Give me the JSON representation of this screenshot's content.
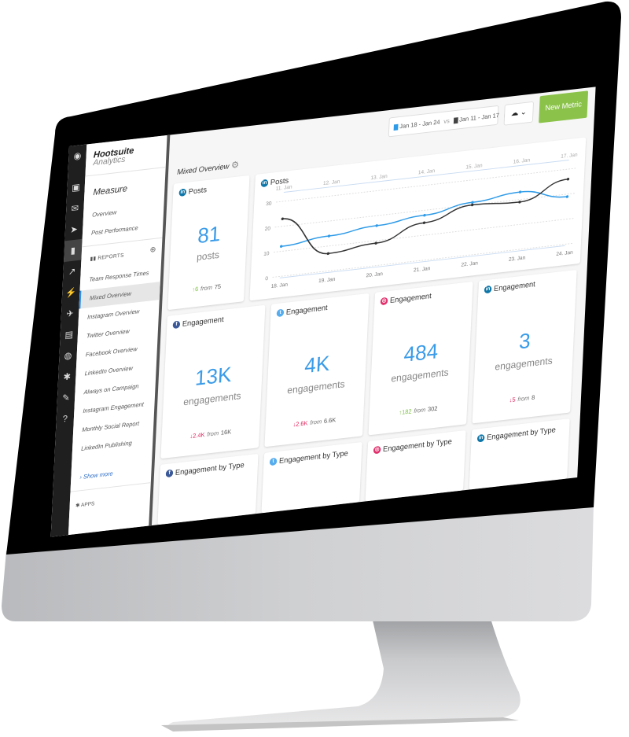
{
  "app": {
    "brand": "Hootsuite",
    "brand_sub": "Analytics"
  },
  "header": {
    "date_range_primary": "Jan 18 - Jan 24",
    "vs_label": "vs",
    "date_range_compare": "Jan 11 - Jan 17",
    "calendar_icon": "calendar-icon",
    "export_icon": "cloud-download-icon",
    "new_metric_label": "New Metric",
    "primary_color": "#2e9be8",
    "compare_color": "#444444",
    "accent_color": "#8bc34a"
  },
  "rail": {
    "icons": [
      "owl-logo-icon",
      "streams-icon",
      "inbox-icon",
      "publisher-icon",
      "analytics-icon",
      "trends-icon",
      "boost-icon",
      "launch-icon",
      "assignments-icon",
      "insights-icon",
      "apps-icon",
      "tools-icon",
      "help-icon"
    ]
  },
  "sidebar": {
    "section_title": "Measure",
    "top_items": [
      {
        "label": "Overview"
      },
      {
        "label": "Post Performance"
      }
    ],
    "reports_label": "REPORTS",
    "reports": [
      {
        "label": "Team Response Times",
        "active": false
      },
      {
        "label": "Mixed Overview",
        "active": true
      },
      {
        "label": "Instagram Overview",
        "active": false
      },
      {
        "label": "Twitter Overview",
        "active": false
      },
      {
        "label": "Facebook Overview",
        "active": false
      },
      {
        "label": "LinkedIn Overview",
        "active": false
      },
      {
        "label": "Always on Campaign",
        "active": false
      },
      {
        "label": "Instagram Engagement",
        "active": false
      },
      {
        "label": "Monthly Social Report",
        "active": false
      },
      {
        "label": "LinkedIn Publishing",
        "active": false
      }
    ],
    "show_more": "Show more",
    "apps_label": "APPS"
  },
  "main": {
    "page_title": "Mixed Overview",
    "posts_card": {
      "network": "linkedin",
      "title": "Posts",
      "value": "81",
      "unit": "posts",
      "delta": "6",
      "delta_dir": "up",
      "from_label": "from",
      "previous": "75"
    },
    "engagement_cards": [
      {
        "network": "facebook",
        "title": "Engagement",
        "value": "13K",
        "unit": "engagements",
        "delta": "2.4K",
        "delta_dir": "down",
        "from_label": "from",
        "previous": "16K"
      },
      {
        "network": "twitter",
        "title": "Engagement",
        "value": "4K",
        "unit": "engagements",
        "delta": "2.6K",
        "delta_dir": "down",
        "from_label": "from",
        "previous": "6.6K"
      },
      {
        "network": "instagram",
        "title": "Engagement",
        "value": "484",
        "unit": "engagements",
        "delta": "182",
        "delta_dir": "up",
        "from_label": "from",
        "previous": "302"
      },
      {
        "network": "linkedin",
        "title": "Engagement",
        "value": "3",
        "unit": "engagements",
        "delta": "5",
        "delta_dir": "down",
        "from_label": "from",
        "previous": "8"
      }
    ],
    "type_cards": [
      {
        "network": "facebook",
        "title": "Engagement by Type"
      },
      {
        "network": "twitter",
        "title": "Engagement by Type"
      },
      {
        "network": "instagram",
        "title": "Engagement by Type"
      },
      {
        "network": "linkedin",
        "title": "Engagement by Type"
      }
    ]
  },
  "networks": {
    "facebook": {
      "color": "#3b5998",
      "glyph": "f"
    },
    "twitter": {
      "color": "#55acee",
      "glyph": "t"
    },
    "instagram": {
      "color": "#e1306c",
      "glyph": "◎"
    },
    "linkedin": {
      "color": "#0e76a8",
      "glyph": "in"
    }
  },
  "chart_data": {
    "type": "line",
    "title": "Posts",
    "network": "linkedin",
    "ylabel": "",
    "ylim": [
      0,
      30
    ],
    "yticks": [
      0,
      10,
      20,
      30
    ],
    "x_primary": [
      "18. Jan",
      "19. Jan",
      "20. Jan",
      "21. Jan",
      "22. Jan",
      "23. Jan",
      "24. Jan"
    ],
    "x_compare": [
      "11. Jan",
      "12. Jan",
      "13. Jan",
      "14. Jan",
      "15. Jan",
      "16. Jan",
      "17. Jan"
    ],
    "grid": true,
    "series": [
      {
        "name": "Jan 18 - Jan 24",
        "color": "#2e9be8",
        "values": [
          12,
          14,
          16,
          18,
          21,
          23,
          19
        ]
      },
      {
        "name": "Jan 11 - Jan 17",
        "color": "#333333",
        "values": [
          23,
          7,
          9,
          15,
          20,
          19,
          26
        ]
      }
    ]
  }
}
